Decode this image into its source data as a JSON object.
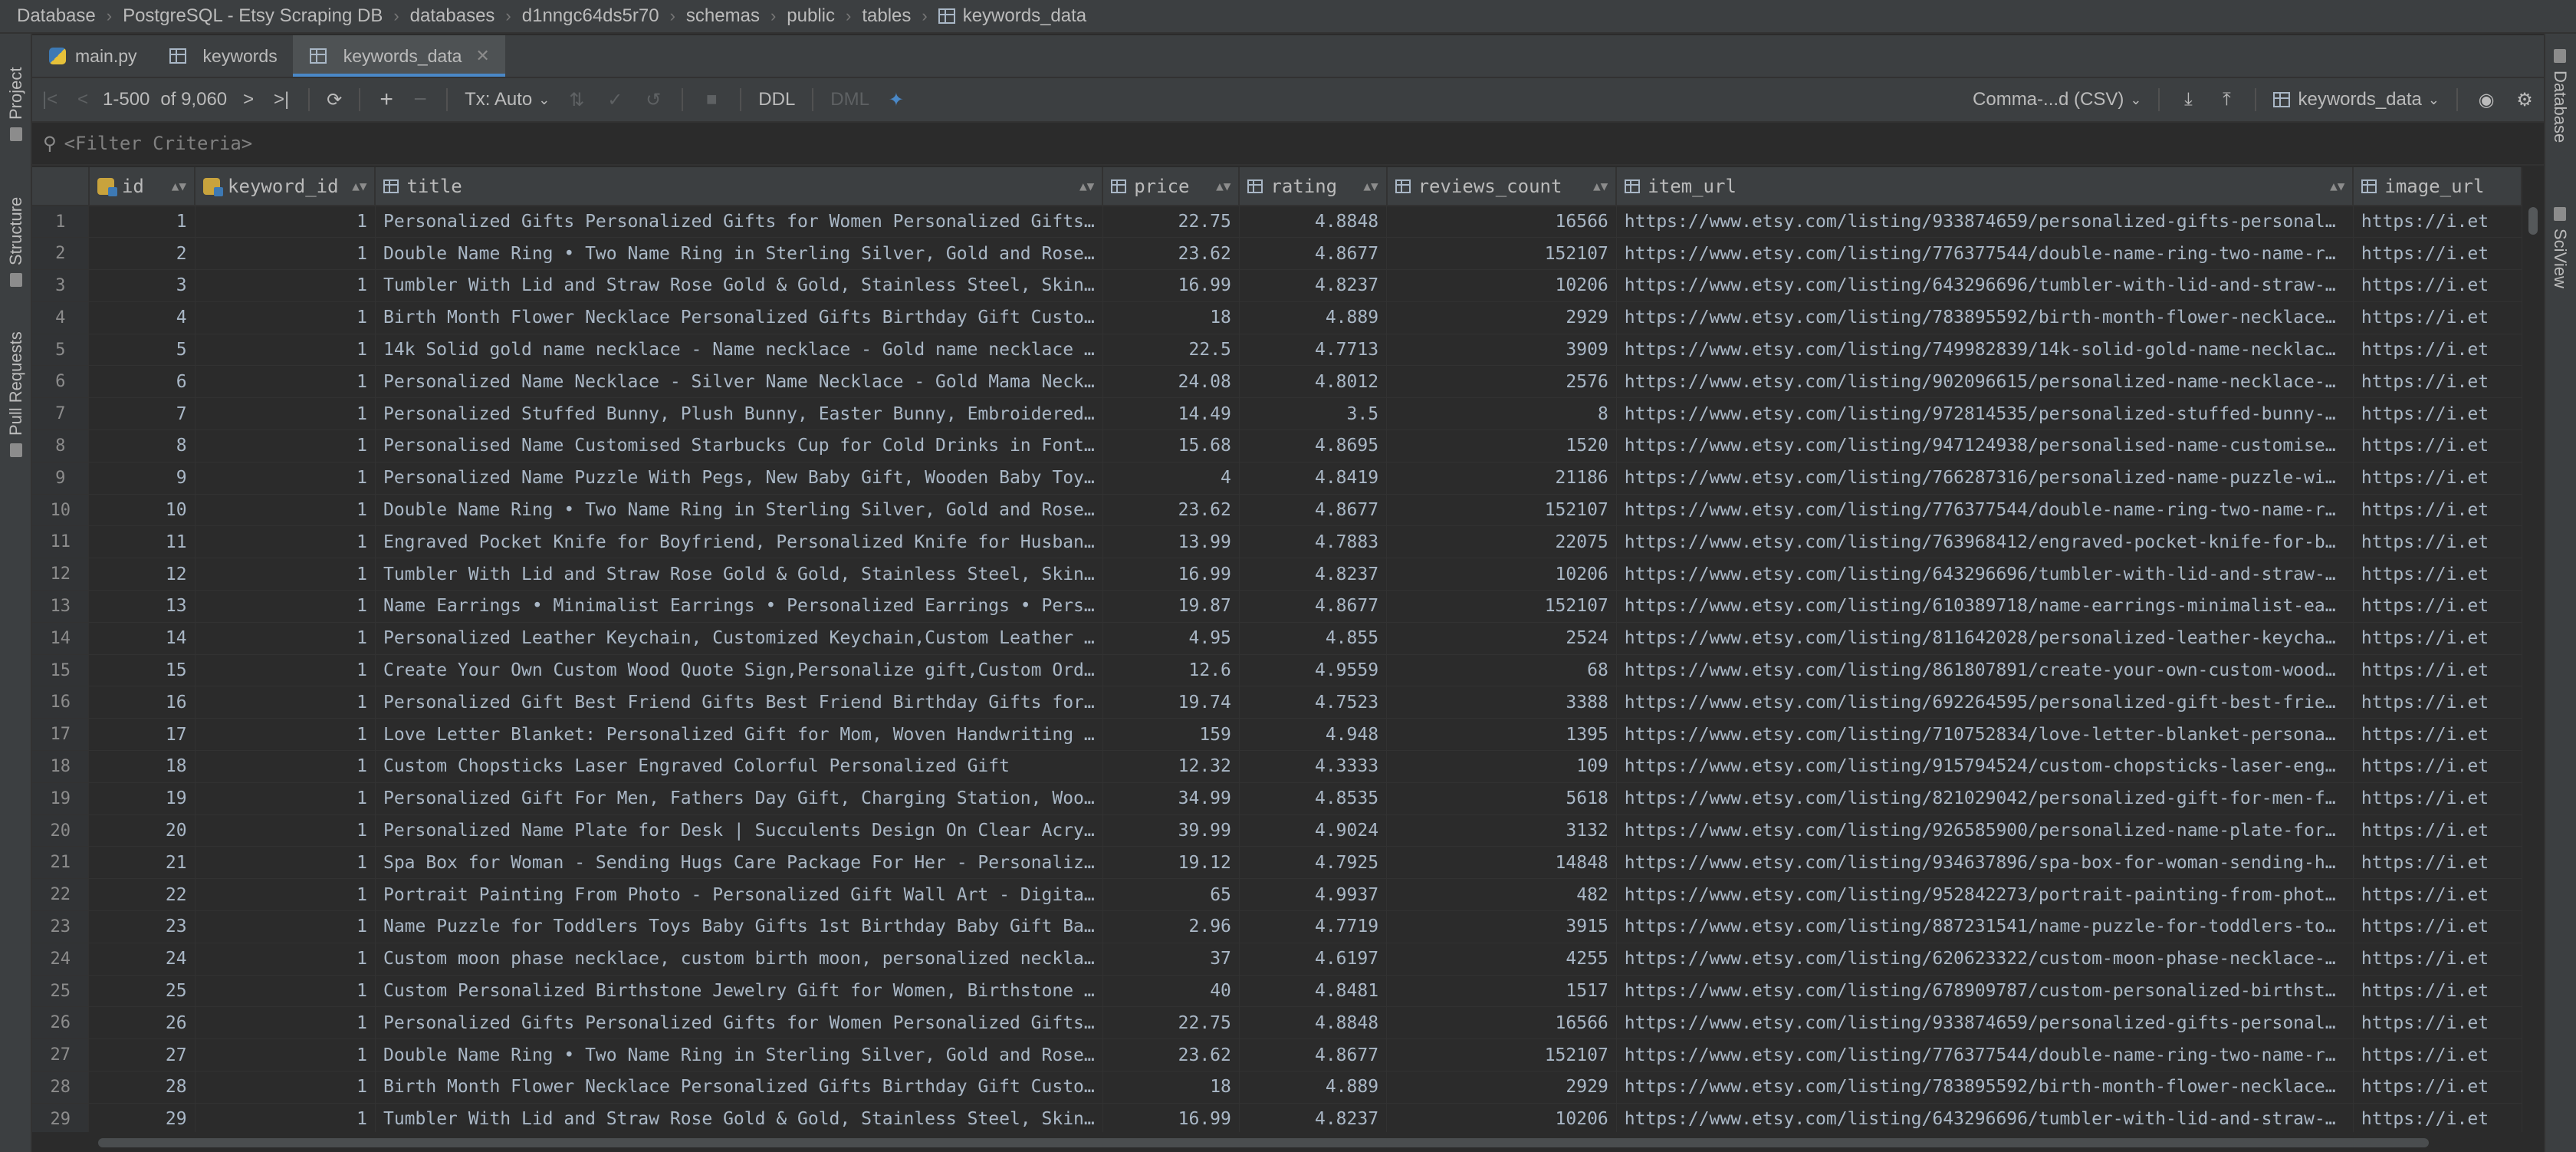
{
  "breadcrumb": [
    "Database",
    "PostgreSQL - Etsy Scraping DB",
    "databases",
    "d1nngc64ds5r70",
    "schemas",
    "public",
    "tables",
    "keywords_data"
  ],
  "left_strip": {
    "project": "Project",
    "structure": "Structure",
    "pull_requests": "Pull Requests"
  },
  "right_strip": {
    "database": "Database",
    "sciview": "SciView"
  },
  "tabs": [
    {
      "label": "main.py",
      "active": false
    },
    {
      "label": "keywords",
      "active": false
    },
    {
      "label": "keywords_data",
      "active": true
    }
  ],
  "toolbar": {
    "range": "1-500",
    "total": "of 9,060",
    "tx": "Tx: Auto",
    "ddl": "DDL",
    "dml": "DML",
    "export_format": "Comma-...d (CSV)",
    "table_selector": "keywords_data"
  },
  "filter": {
    "placeholder": "<Filter Criteria>"
  },
  "columns": [
    "id",
    "keyword_id",
    "title",
    "price",
    "rating",
    "reviews_count",
    "item_url",
    "image_url"
  ],
  "rows": [
    [
      "1",
      "1",
      "1",
      "Personalized Gifts Personalized Gifts for Women Personalized Gifts…",
      "22.75",
      "4.8848",
      "16566",
      "https://www.etsy.com/listing/933874659/personalized-gifts-personal…",
      "https://i.et"
    ],
    [
      "2",
      "2",
      "1",
      "Double Name Ring • Two Name Ring in Sterling Silver, Gold and Rose…",
      "23.62",
      "4.8677",
      "152107",
      "https://www.etsy.com/listing/776377544/double-name-ring-two-name-r…",
      "https://i.et"
    ],
    [
      "3",
      "3",
      "1",
      "Tumbler With Lid and Straw Rose Gold & Gold, Stainless Steel, Skin…",
      "16.99",
      "4.8237",
      "10206",
      "https://www.etsy.com/listing/643296696/tumbler-with-lid-and-straw-…",
      "https://i.et"
    ],
    [
      "4",
      "4",
      "1",
      "Birth Month Flower Necklace Personalized Gifts Birthday Gift Custo…",
      "18",
      "4.889",
      "2929",
      "https://www.etsy.com/listing/783895592/birth-month-flower-necklace…",
      "https://i.et"
    ],
    [
      "5",
      "5",
      "1",
      "14k Solid gold name necklace - Name necklace - Gold name necklace …",
      "22.5",
      "4.7713",
      "3909",
      "https://www.etsy.com/listing/749982839/14k-solid-gold-name-necklac…",
      "https://i.et"
    ],
    [
      "6",
      "6",
      "1",
      "Personalized Name Necklace - Silver Name Necklace - Gold Mama Neck…",
      "24.08",
      "4.8012",
      "2576",
      "https://www.etsy.com/listing/902096615/personalized-name-necklace-…",
      "https://i.et"
    ],
    [
      "7",
      "7",
      "1",
      "Personalized Stuffed Bunny, Plush Bunny, Easter Bunny, Embroidered…",
      "14.49",
      "3.5",
      "8",
      "https://www.etsy.com/listing/972814535/personalized-stuffed-bunny-…",
      "https://i.et"
    ],
    [
      "8",
      "8",
      "1",
      "Personalised Name Customised Starbucks Cup for Cold Drinks in Font…",
      "15.68",
      "4.8695",
      "1520",
      "https://www.etsy.com/listing/947124938/personalised-name-customise…",
      "https://i.et"
    ],
    [
      "9",
      "9",
      "1",
      "Personalized Name Puzzle With Pegs, New Baby Gift, Wooden Baby Toy…",
      "4",
      "4.8419",
      "21186",
      "https://www.etsy.com/listing/766287316/personalized-name-puzzle-wi…",
      "https://i.et"
    ],
    [
      "10",
      "10",
      "1",
      "Double Name Ring • Two Name Ring in Sterling Silver, Gold and Rose…",
      "23.62",
      "4.8677",
      "152107",
      "https://www.etsy.com/listing/776377544/double-name-ring-two-name-r…",
      "https://i.et"
    ],
    [
      "11",
      "11",
      "1",
      "Engraved Pocket Knife for Boyfriend, Personalized Knife for Husban…",
      "13.99",
      "4.7883",
      "22075",
      "https://www.etsy.com/listing/763968412/engraved-pocket-knife-for-b…",
      "https://i.et"
    ],
    [
      "12",
      "12",
      "1",
      "Tumbler With Lid and Straw Rose Gold & Gold, Stainless Steel, Skin…",
      "16.99",
      "4.8237",
      "10206",
      "https://www.etsy.com/listing/643296696/tumbler-with-lid-and-straw-…",
      "https://i.et"
    ],
    [
      "13",
      "13",
      "1",
      "Name Earrings • Minimalist Earrings • Personalized Earrings • Pers…",
      "19.87",
      "4.8677",
      "152107",
      "https://www.etsy.com/listing/610389718/name-earrings-minimalist-ea…",
      "https://i.et"
    ],
    [
      "14",
      "14",
      "1",
      "Personalized Leather Keychain, Customized Keychain,Custom Leather …",
      "4.95",
      "4.855",
      "2524",
      "https://www.etsy.com/listing/811642028/personalized-leather-keycha…",
      "https://i.et"
    ],
    [
      "15",
      "15",
      "1",
      "Create Your Own Custom Wood Quote Sign,Personalize gift,Custom Ord…",
      "12.6",
      "4.9559",
      "68",
      "https://www.etsy.com/listing/861807891/create-your-own-custom-wood…",
      "https://i.et"
    ],
    [
      "16",
      "16",
      "1",
      "Personalized Gift Best Friend Gifts Best Friend Birthday Gifts for…",
      "19.74",
      "4.7523",
      "3388",
      "https://www.etsy.com/listing/692264595/personalized-gift-best-frie…",
      "https://i.et"
    ],
    [
      "17",
      "17",
      "1",
      "Love Letter Blanket: Personalized Gift for Mom, Woven Handwriting …",
      "159",
      "4.948",
      "1395",
      "https://www.etsy.com/listing/710752834/love-letter-blanket-persona…",
      "https://i.et"
    ],
    [
      "18",
      "18",
      "1",
      "Custom Chopsticks Laser Engraved Colorful Personalized Gift",
      "12.32",
      "4.3333",
      "109",
      "https://www.etsy.com/listing/915794524/custom-chopsticks-laser-eng…",
      "https://i.et"
    ],
    [
      "19",
      "19",
      "1",
      "Personalized Gift For Men, Fathers Day Gift, Charging Station, Woo…",
      "34.99",
      "4.8535",
      "5618",
      "https://www.etsy.com/listing/821029042/personalized-gift-for-men-f…",
      "https://i.et"
    ],
    [
      "20",
      "20",
      "1",
      "Personalized Name Plate for Desk | Succulents Design On Clear Acry…",
      "39.99",
      "4.9024",
      "3132",
      "https://www.etsy.com/listing/926585900/personalized-name-plate-for…",
      "https://i.et"
    ],
    [
      "21",
      "21",
      "1",
      "Spa Box for Woman - Sending Hugs Care Package For Her - Personaliz…",
      "19.12",
      "4.7925",
      "14848",
      "https://www.etsy.com/listing/934637896/spa-box-for-woman-sending-h…",
      "https://i.et"
    ],
    [
      "22",
      "22",
      "1",
      "Portrait Painting From Photo - Personalized Gift Wall Art - Digita…",
      "65",
      "4.9937",
      "482",
      "https://www.etsy.com/listing/952842273/portrait-painting-from-phot…",
      "https://i.et"
    ],
    [
      "23",
      "23",
      "1",
      "Name Puzzle for Toddlers Toys Baby Gifts 1st Birthday Baby Gift Ba…",
      "2.96",
      "4.7719",
      "3915",
      "https://www.etsy.com/listing/887231541/name-puzzle-for-toddlers-to…",
      "https://i.et"
    ],
    [
      "24",
      "24",
      "1",
      "Custom moon phase necklace, custom birth moon, personalized neckla…",
      "37",
      "4.6197",
      "4255",
      "https://www.etsy.com/listing/620623322/custom-moon-phase-necklace-…",
      "https://i.et"
    ],
    [
      "25",
      "25",
      "1",
      "Custom Personalized Birthstone Jewelry Gift for Women, Birthstone …",
      "40",
      "4.8481",
      "1517",
      "https://www.etsy.com/listing/678909787/custom-personalized-birthst…",
      "https://i.et"
    ],
    [
      "26",
      "26",
      "1",
      "Personalized Gifts Personalized Gifts for Women Personalized Gifts…",
      "22.75",
      "4.8848",
      "16566",
      "https://www.etsy.com/listing/933874659/personalized-gifts-personal…",
      "https://i.et"
    ],
    [
      "27",
      "27",
      "1",
      "Double Name Ring • Two Name Ring in Sterling Silver, Gold and Rose…",
      "23.62",
      "4.8677",
      "152107",
      "https://www.etsy.com/listing/776377544/double-name-ring-two-name-r…",
      "https://i.et"
    ],
    [
      "28",
      "28",
      "1",
      "Birth Month Flower Necklace Personalized Gifts Birthday Gift Custo…",
      "18",
      "4.889",
      "2929",
      "https://www.etsy.com/listing/783895592/birth-month-flower-necklace…",
      "https://i.et"
    ],
    [
      "29",
      "29",
      "1",
      "Tumbler With Lid and Straw Rose Gold & Gold, Stainless Steel, Skin…",
      "16.99",
      "4.8237",
      "10206",
      "https://www.etsy.com/listing/643296696/tumbler-with-lid-and-straw-…",
      "https://i.et"
    ]
  ],
  "icons": [
    "python-file-icon",
    "table-icon",
    "close-icon",
    "first-page-icon",
    "prev-page-icon",
    "next-page-icon",
    "last-page-icon",
    "refresh-icon",
    "add-row-icon",
    "delete-row-icon",
    "submit-icon",
    "rollback-icon",
    "stop-icon",
    "compare-icon",
    "download-icon",
    "upload-icon",
    "eye-icon",
    "gear-icon",
    "search-icon",
    "key-icon",
    "sort-icon"
  ],
  "colors": {
    "background": "#2b2b2b",
    "panel": "#3c3f41",
    "accent": "#4a88c7",
    "text": "#bbbbbb",
    "cell_text": "#a9b7c6"
  }
}
